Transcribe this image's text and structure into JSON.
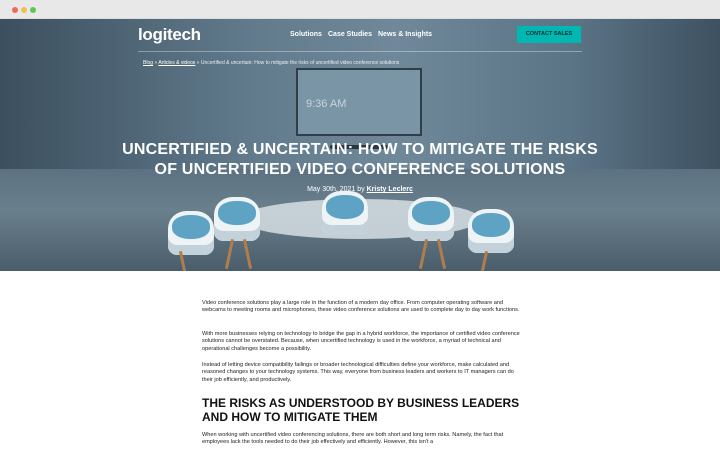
{
  "browser": {
    "window": "browser-window"
  },
  "header": {
    "logo": "logitech",
    "nav": [
      "Solutions",
      "Case Studies",
      "News & Insights"
    ],
    "cta": "CONTACT SALES"
  },
  "hero": {
    "tv_time": "9:36 AM",
    "breadcrumb": {
      "blog": "Blog",
      "sep1": "»",
      "articles": "Articles & videos",
      "sep2": "»",
      "current": "Uncertified & uncertain: How to mitigate the risks of uncertified video conference solutions"
    },
    "title": "Uncertified & Uncertain: How to Mitigate the Risks of Uncertified Video Conference Solutions",
    "date": "May 30th, 2021 by",
    "author": "Kristy Leclerc"
  },
  "article": {
    "p1": "Video conference solutions play a large role in the function of a modern day office. From computer operating software and webcams to meeting rooms and microphones, these video conference solutions are used to complete day to day work functions.",
    "p2": "With more businesses relying on technology to bridge the gap in a hybrid workforce, the importance of certified video conference solutions cannot be overstated. Because, when uncertified technology is used in the workforce, a myriad of technical and operational challenges become a possibility.",
    "p3": "Instead of letting device compatibility failings or broader technological difficulties define your workforce, make calculated and reasoned changes to your technology systems. This way, everyone from business leaders and workers to IT managers can do their job efficiently, and productively.",
    "h2": "The Risks as Understood by Business Leaders and How to Mitigate Them",
    "p4": "When working with uncertified video conferencing solutions, there are both short and long term risks. Namely, the fact that employees lack the tools needed to do their job effectively and efficiently. However, this isn't a"
  }
}
